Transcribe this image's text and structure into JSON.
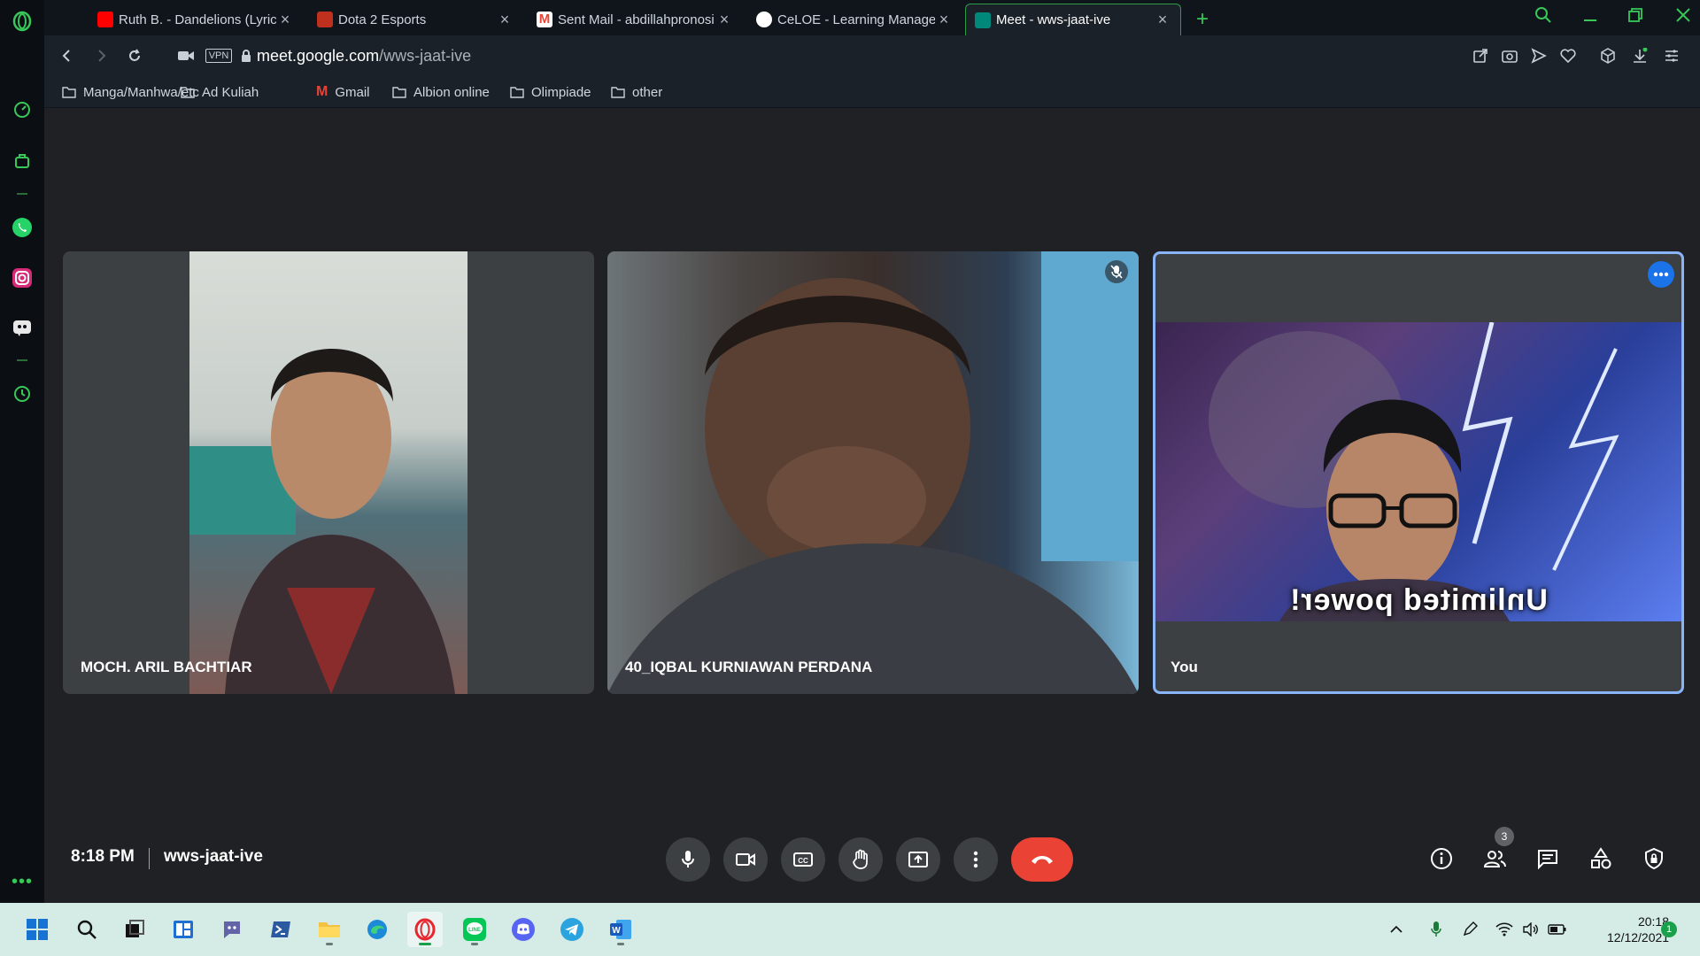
{
  "browser": {
    "tabs": [
      {
        "title": "Ruth B. - Dandelions (Lyrics",
        "favicon_color": "#ff0000"
      },
      {
        "title": "Dota 2 Esports",
        "favicon_color": "#c0301e"
      },
      {
        "title": "Sent Mail - abdillahpronosi",
        "favicon_color": "#ea4335"
      },
      {
        "title": "CeLOE - Learning Managem",
        "favicon_color": "#ffffff"
      },
      {
        "title": "Meet - wws-jaat-ive",
        "favicon_color": "#00897b",
        "active": true
      }
    ],
    "address": {
      "vpn_label": "VPN",
      "url_host": "meet.google.com",
      "url_path": "/wws-jaat-ive"
    },
    "bookmarks": [
      "Manga/Manhwa/etc",
      "Ad Kuliah",
      "Gmail",
      "Albion online",
      "Olimpiade",
      "other"
    ]
  },
  "meet": {
    "participants": [
      {
        "name": "MOCH. ARIL BACHTIAR"
      },
      {
        "name": "40_IQBAL KURNIAWAN PERDANA",
        "muted": true
      },
      {
        "name": "You",
        "self": true,
        "video_caption": "Unlimited power!"
      }
    ],
    "time": "8:18 PM",
    "meeting_code": "wws-jaat-ive",
    "people_count": "3",
    "colors": {
      "end_call": "#ea4335",
      "accent": "#8ab4f8",
      "background": "#202124"
    }
  },
  "taskbar": {
    "time": "20:18",
    "date": "12/12/2021",
    "notification_count": "1"
  }
}
